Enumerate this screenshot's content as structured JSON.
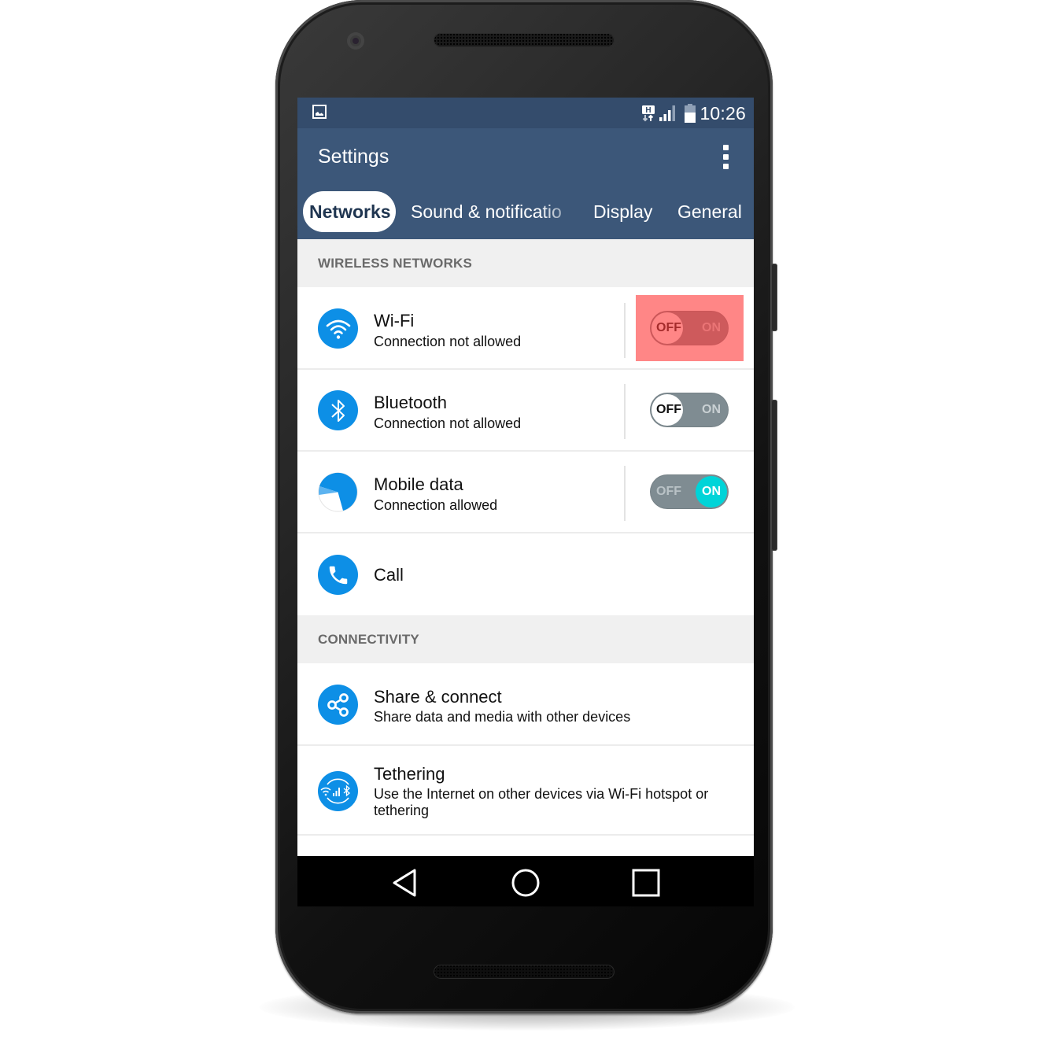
{
  "status_bar": {
    "left_icon": "image-notification-icon",
    "icons": [
      "hspa-data-icon",
      "signal-strength-icon",
      "battery-icon"
    ],
    "time": "10:26"
  },
  "app_bar": {
    "title": "Settings",
    "overflow_icon": "more-vert-icon"
  },
  "tabs": [
    {
      "label": "Networks",
      "active": true
    },
    {
      "label": "Sound & notificatio",
      "active": false
    },
    {
      "label": "Display",
      "active": false
    },
    {
      "label": "General",
      "active": false
    }
  ],
  "sections": [
    {
      "header": "WIRELESS NETWORKS",
      "items": [
        {
          "icon": "wifi-icon",
          "title": "Wi-Fi",
          "subtitle": "Connection not allowed",
          "toggle": {
            "state": "off",
            "off_label": "OFF",
            "on_label": "ON",
            "highlighted": true
          }
        },
        {
          "icon": "bluetooth-icon",
          "title": "Bluetooth",
          "subtitle": "Connection not allowed",
          "toggle": {
            "state": "off",
            "off_label": "OFF",
            "on_label": "ON"
          }
        },
        {
          "icon": "mobile-data-icon",
          "title": "Mobile data",
          "subtitle": "Connection allowed",
          "toggle": {
            "state": "on",
            "off_label": "OFF",
            "on_label": "ON"
          }
        },
        {
          "icon": "phone-icon",
          "title": "Call"
        }
      ]
    },
    {
      "header": "CONNECTIVITY",
      "items": [
        {
          "icon": "share-icon",
          "title": "Share & connect",
          "subtitle": "Share data and media with other devices"
        },
        {
          "icon": "tethering-icon",
          "title": "Tethering",
          "subtitle": "Use the Internet on other devices via Wi-Fi hotspot or tethering"
        }
      ]
    }
  ],
  "nav_bar": {
    "buttons": [
      "back-icon",
      "home-icon",
      "recents-icon"
    ]
  },
  "colors": {
    "status_bar": "#344c6c",
    "app_bar": "#3c5779",
    "icon_blue": "#0d8fe6",
    "toggle_on": "#00d4d8",
    "toggle_track": "#7f8c92",
    "highlight": "#ff5c5c"
  }
}
